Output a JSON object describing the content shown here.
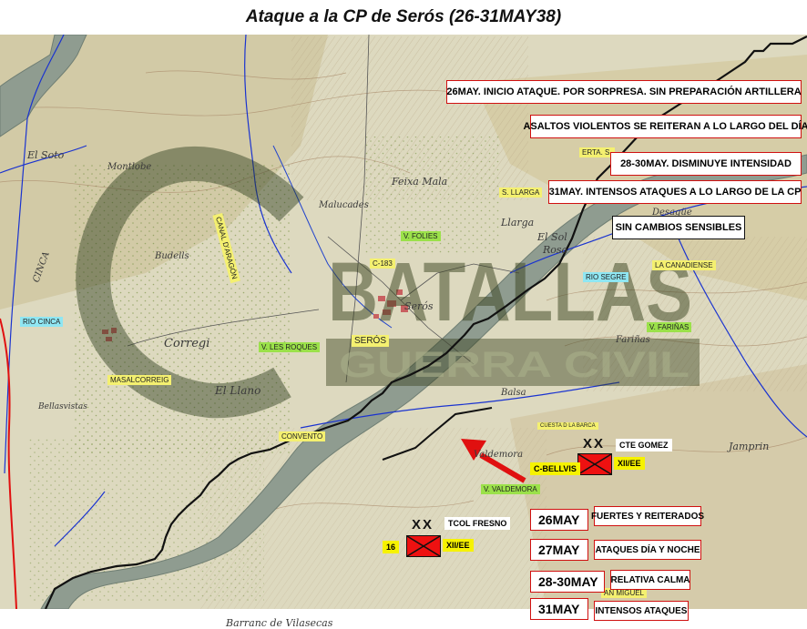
{
  "title": "Ataque a la CP de Serós (26-31MAY38)",
  "colors": {
    "front_line": "#111111",
    "attack_arrow": "#e01010",
    "river": "#1a33d0",
    "boundary": "#e01010",
    "unit_fill": "#ee1111"
  },
  "icons": {
    "attack": "red-arrow-icon",
    "unit": "infantry-unit-symbol"
  },
  "notes": [
    "26MAY. INICIO ATAQUE.  POR SORPRESA. SIN PREPARACIÓN ARTILLERA",
    "ASALTOS VIOLENTOS SE REITERAN A LO LARGO DEL DÍA",
    "28-30MAY. DISMINUYE  INTENSIDAD",
    "31MAY. INTENSOS ATAQUES A LO LARGO DE LA CP",
    "SIN CAMBIOS SENSIBLES"
  ],
  "phases": [
    {
      "date": "26MAY",
      "desc": "FUERTES Y REITERADOS"
    },
    {
      "date": "27MAY",
      "desc": "ATAQUES DÍA Y NOCHE"
    },
    {
      "date": "28-30MAY",
      "desc": "RELATIVA CALMA"
    },
    {
      "date": "31MAY",
      "desc": "INTENSOS ATAQUES"
    }
  ],
  "units": {
    "gomez": {
      "name": "CTE GOMEZ",
      "left": "C-BELLVIS",
      "right": "XII/EE",
      "echelon": "XX"
    },
    "fresno": {
      "name": "TCOL FRESNO",
      "left": "16",
      "right": "XII/EE",
      "echelon": "XX"
    }
  },
  "place_tags": {
    "rio_cinca": "RIO CINCA",
    "canal_aragon": "CANAL D'ARAGÓN",
    "masalcorreig": "MASALCORREIG",
    "les_roques": "V. LES ROQUES",
    "folies": "V. FOLIES",
    "c183": "C-183",
    "seros": "SERÓS",
    "convento": "CONVENTO",
    "erta": "ERTA. S.",
    "llarga": "S. LLARGA",
    "rio_segre": "RIO SEGRE",
    "canadiense": "LA CANADIENSE",
    "farinas": "V. FARIÑAS",
    "valdemora": "V. VALDEMORA",
    "cuesta": "CUESTA D LA BARCA",
    "san_miguel": "AN MIGUEL"
  },
  "map_text": {
    "el_soto_1": "El Soto",
    "el_soto_2": "El Soto",
    "montlobe": "Montlobe",
    "budells": "Budells",
    "corregi": "Corregi",
    "el_llano": "El Llano",
    "bellasvistas": "Bellasvistas",
    "rio_lbl": "Rio",
    "cinca_lbl": "CINCA",
    "seros_map": "Serós",
    "malucades": "Malucades",
    "feixa": "Feixa Mala",
    "llarga_map": "Llarga",
    "el_sol": "El Sol",
    "el_rosa": "Rosa",
    "desagua": "Desagüe",
    "jamprin": "Jamprin",
    "barranco": "Barranc de Vilasecas",
    "valdemora_map": "Valdemora",
    "balsa": "Balsa",
    "farinas_map": "Fariñas"
  },
  "watermark": {
    "line1": "BATALLAS",
    "line2": "GUERRA CIVIL"
  }
}
